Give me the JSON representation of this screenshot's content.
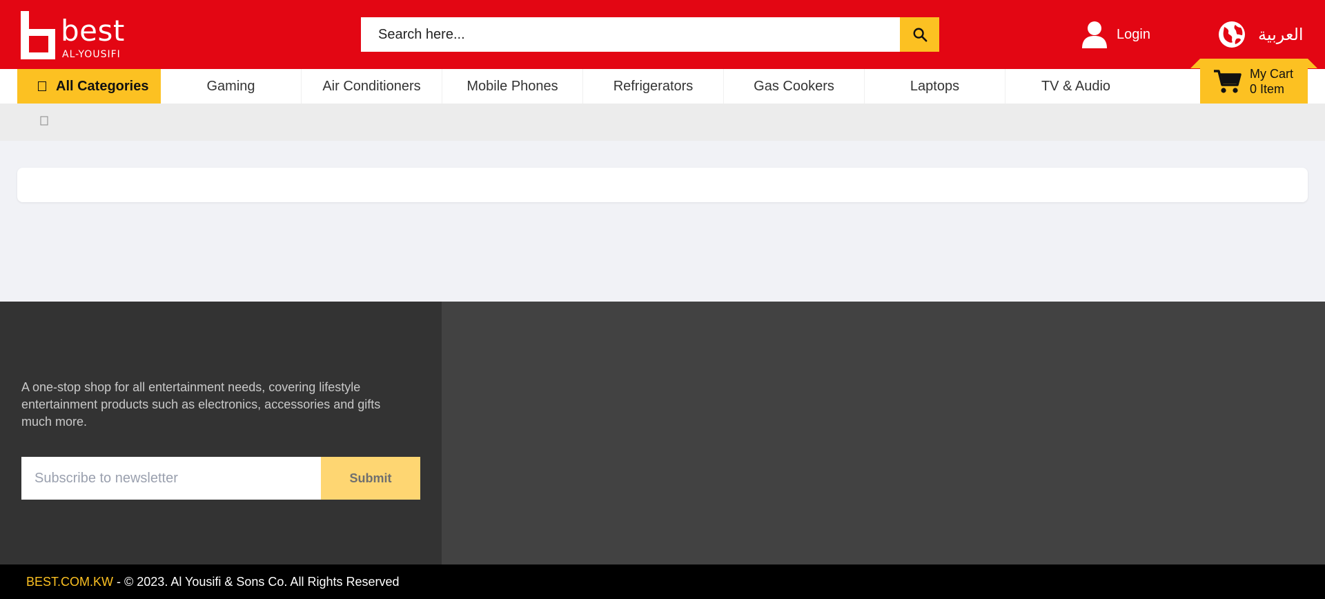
{
  "header": {
    "logo_word": "best",
    "logo_sub": "AL-YOUSIFI",
    "search_placeholder": "Search here...",
    "login_label": "Login",
    "lang_label": "العربية",
    "brand_color": "#e30613",
    "accent_color": "#fcc122"
  },
  "nav": {
    "all_categories_label": "All Categories",
    "items": [
      {
        "label": "Gaming"
      },
      {
        "label": "Air Conditioners"
      },
      {
        "label": "Mobile Phones"
      },
      {
        "label": "Refrigerators"
      },
      {
        "label": "Gas Cookers"
      },
      {
        "label": "Laptops"
      },
      {
        "label": "TV & Audio"
      }
    ]
  },
  "cart": {
    "title": "My Cart",
    "count_label": "0 Item"
  },
  "footer": {
    "description": "A one-stop shop for all entertainment needs, covering lifestyle entertainment products such as electronics, accessories and gifts much more.",
    "newsletter_placeholder": "Subscribe to newsletter",
    "submit_label": "Submit",
    "copyright_brand": "BEST.COM.KW",
    "copyright_text": " - © 2023. Al Yousifi & Sons Co. All Rights Reserved"
  },
  "icons": {
    "search": "search-icon",
    "user": "user-icon",
    "globe": "globe-icon",
    "cart": "cart-icon",
    "menu": "menu-icon",
    "home": "home-icon"
  }
}
